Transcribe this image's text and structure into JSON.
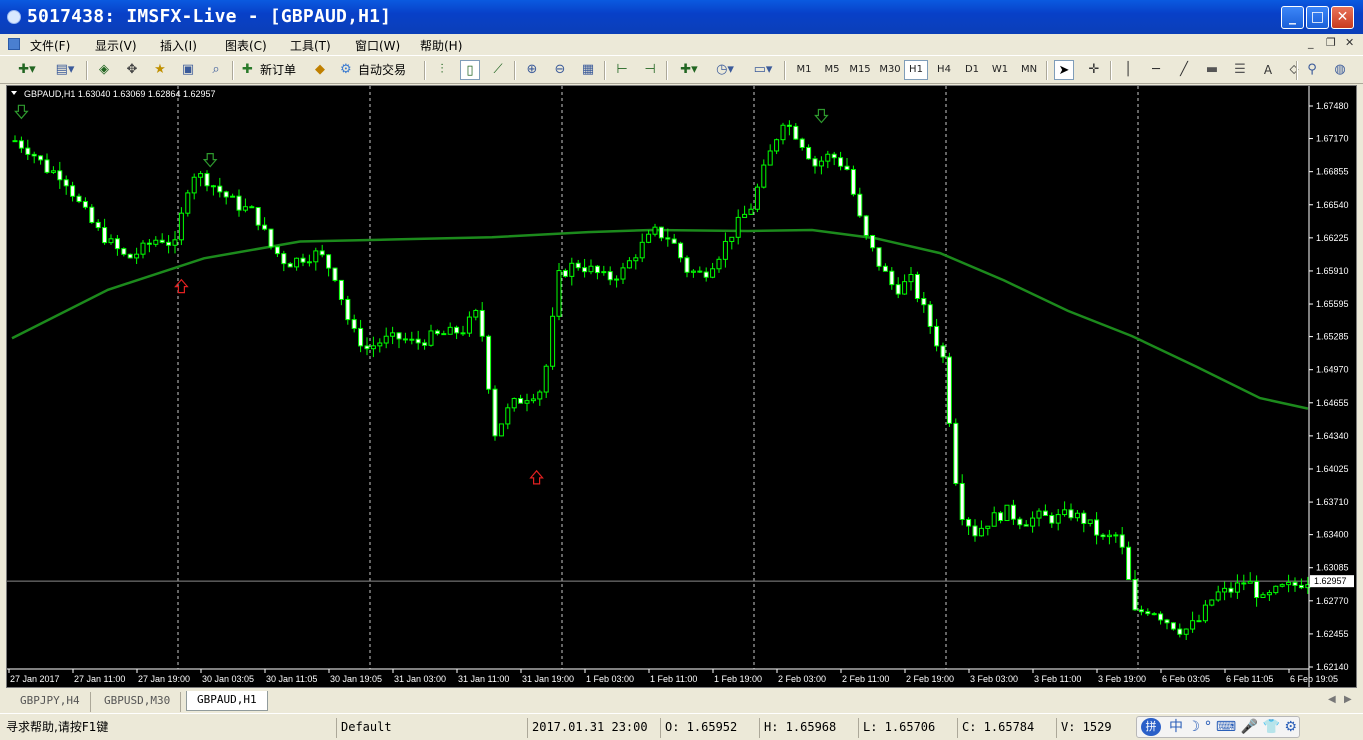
{
  "window": {
    "title": "5017438: IMSFX-Live - [GBPAUD,H1]"
  },
  "menu": [
    "文件(F)",
    "显示(V)",
    "插入(I)",
    "图表(C)",
    "工具(T)",
    "窗口(W)",
    "帮助(H)"
  ],
  "toolbar": {
    "new_order": "新订单",
    "auto_trading": "自动交易",
    "timeframes": [
      "M1",
      "M5",
      "M15",
      "M30",
      "H1",
      "H4",
      "D1",
      "W1",
      "MN"
    ],
    "active_timeframe": "H1",
    "text_tool": "A"
  },
  "chart_info": "GBPAUD,H1  1.63040 1.63069 1.62864 1.62957",
  "current_price": "1.62957",
  "chart_data": {
    "type": "candlestick",
    "symbol": "GBPAUD",
    "timeframe": "H1",
    "ohlc_header": {
      "open": 1.6304,
      "high": 1.63069,
      "low": 1.62864,
      "close": 1.62957
    },
    "ylim": [
      1.6214,
      1.6748
    ],
    "y_ticks": [
      "1.67480",
      "1.67170",
      "1.66855",
      "1.66540",
      "1.66225",
      "1.65910",
      "1.65595",
      "1.65285",
      "1.64970",
      "1.64655",
      "1.64340",
      "1.64025",
      "1.63710",
      "1.63400",
      "1.63085",
      "1.62770",
      "1.62455",
      "1.62140"
    ],
    "x_ticks": [
      "27 Jan 2017",
      "27 Jan 11:00",
      "27 Jan 19:00",
      "30 Jan 03:05",
      "30 Jan 11:05",
      "30 Jan 19:05",
      "31 Jan 03:00",
      "31 Jan 11:00",
      "31 Jan 19:00",
      "1 Feb 03:00",
      "1 Feb 11:00",
      "1 Feb 19:00",
      "2 Feb 03:00",
      "2 Feb 11:00",
      "2 Feb 19:00",
      "3 Feb 03:00",
      "3 Feb 11:00",
      "3 Feb 19:00",
      "6 Feb 03:05",
      "6 Feb 11:05",
      "6 Feb 19:05"
    ],
    "close_path": [
      [
        0,
        1.6715
      ],
      [
        5,
        1.6705
      ],
      [
        10,
        1.6688
      ],
      [
        15,
        1.6682
      ],
      [
        20,
        1.6655
      ],
      [
        25,
        1.6632
      ],
      [
        30,
        1.6617
      ],
      [
        35,
        1.6602
      ],
      [
        40,
        1.6612
      ],
      [
        45,
        1.6623
      ],
      [
        50,
        1.6615
      ],
      [
        55,
        1.6685
      ],
      [
        60,
        1.6678
      ],
      [
        65,
        1.6664
      ],
      [
        70,
        1.6653
      ],
      [
        75,
        1.6646
      ],
      [
        80,
        1.6614
      ],
      [
        85,
        1.6598
      ],
      [
        90,
        1.6604
      ],
      [
        95,
        1.6608
      ],
      [
        100,
        1.6587
      ],
      [
        105,
        1.6535
      ],
      [
        110,
        1.6517
      ],
      [
        115,
        1.6525
      ],
      [
        120,
        1.6527
      ],
      [
        125,
        1.6522
      ],
      [
        130,
        1.6528
      ],
      [
        135,
        1.6531
      ],
      [
        140,
        1.6535
      ],
      [
        145,
        1.6553
      ],
      [
        150,
        1.6437
      ],
      [
        155,
        1.6463
      ],
      [
        160,
        1.6472
      ],
      [
        165,
        1.6479
      ],
      [
        170,
        1.6586
      ],
      [
        175,
        1.6598
      ],
      [
        180,
        1.6592
      ],
      [
        185,
        1.6583
      ],
      [
        190,
        1.6591
      ],
      [
        195,
        1.6612
      ],
      [
        200,
        1.6628
      ],
      [
        205,
        1.6622
      ],
      [
        210,
        1.6592
      ],
      [
        215,
        1.6587
      ],
      [
        220,
        1.6607
      ],
      [
        225,
        1.6632
      ],
      [
        230,
        1.6652
      ],
      [
        235,
        1.6695
      ],
      [
        240,
        1.6735
      ],
      [
        245,
        1.6718
      ],
      [
        250,
        1.6692
      ],
      [
        255,
        1.6702
      ],
      [
        260,
        1.6688
      ],
      [
        265,
        1.6628
      ],
      [
        270,
        1.6598
      ],
      [
        275,
        1.6573
      ],
      [
        280,
        1.6582
      ],
      [
        285,
        1.6547
      ],
      [
        290,
        1.6508
      ],
      [
        295,
        1.6365
      ],
      [
        300,
        1.6342
      ],
      [
        305,
        1.6355
      ],
      [
        310,
        1.6362
      ],
      [
        315,
        1.6352
      ],
      [
        320,
        1.6357
      ],
      [
        325,
        1.6355
      ],
      [
        330,
        1.636
      ],
      [
        335,
        1.6352
      ],
      [
        340,
        1.6335
      ],
      [
        345,
        1.634
      ],
      [
        350,
        1.6265
      ],
      [
        355,
        1.627
      ],
      [
        360,
        1.6258
      ],
      [
        365,
        1.6248
      ],
      [
        370,
        1.6258
      ],
      [
        375,
        1.6283
      ],
      [
        380,
        1.6287
      ],
      [
        385,
        1.6297
      ],
      [
        390,
        1.6277
      ],
      [
        395,
        1.6288
      ],
      [
        400,
        1.6292
      ],
      [
        405,
        1.6298
      ]
    ],
    "moving_average": [
      [
        0,
        1.6527
      ],
      [
        30,
        1.6573
      ],
      [
        60,
        1.6603
      ],
      [
        90,
        1.6619
      ],
      [
        120,
        1.6621
      ],
      [
        150,
        1.6623
      ],
      [
        180,
        1.6628
      ],
      [
        200,
        1.663
      ],
      [
        230,
        1.6629
      ],
      [
        250,
        1.663
      ],
      [
        270,
        1.6622
      ],
      [
        290,
        1.6608
      ],
      [
        310,
        1.6582
      ],
      [
        330,
        1.6553
      ],
      [
        350,
        1.6529
      ],
      [
        370,
        1.65
      ],
      [
        390,
        1.647
      ],
      [
        405,
        1.646
      ]
    ],
    "ma_color": "#1c8a1c",
    "up_color": "#00ff00",
    "down_color": "#ffffff",
    "sell_arrows": [
      {
        "index": 2,
        "price": 1.6742
      },
      {
        "index": 61,
        "price": 1.6696
      },
      {
        "index": 252,
        "price": 1.6738
      }
    ],
    "buy_arrows": [
      {
        "index": 52,
        "price": 1.6577
      },
      {
        "index": 163,
        "price": 1.6395
      }
    ]
  },
  "chart_tabs": [
    "GBPJPY,H4",
    "GBPUSD,M30",
    "GBPAUD,H1"
  ],
  "active_tab": "GBPAUD,H1",
  "status": {
    "help": "寻求帮助,请按F1键",
    "profile": "Default",
    "datetime": "2017.01.31 23:00",
    "open": "O: 1.65952",
    "high": "H: 1.65968",
    "low": "L: 1.65706",
    "close": "C: 1.65784",
    "volume": "V: 1529"
  },
  "ime": {
    "logo": "拼",
    "text": "中 ☽ ° ⌨ 🎤 👕 ⚙"
  }
}
